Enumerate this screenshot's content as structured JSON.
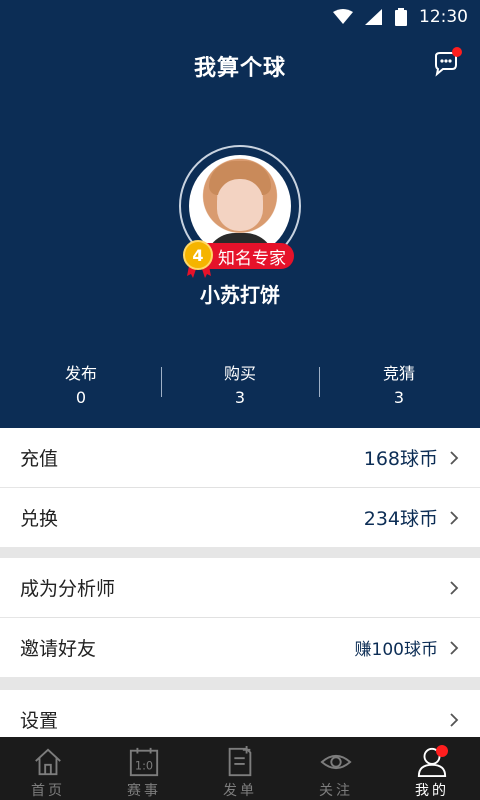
{
  "status_bar": {
    "time": "12:30",
    "icons": [
      "wifi-icon",
      "signal-icon",
      "battery-icon"
    ]
  },
  "header": {
    "title": "我算个球",
    "message_icon": "chat-bubble-icon",
    "profile": {
      "level": "4",
      "badge": "知名专家",
      "name": "小苏打饼"
    },
    "stats": [
      {
        "label": "发布",
        "value": "0"
      },
      {
        "label": "购买",
        "value": "3"
      },
      {
        "label": "竞猜",
        "value": "3"
      }
    ]
  },
  "menu": {
    "recharge": {
      "label": "充值",
      "value": "168球币"
    },
    "exchange": {
      "label": "兑换",
      "value": "234球币"
    },
    "become_analyst": {
      "label": "成为分析师"
    },
    "invite": {
      "label": "邀请好友",
      "value": "赚100球币"
    },
    "settings": {
      "label": "设置"
    }
  },
  "tabbar": {
    "items": [
      {
        "label": "首页",
        "icon": "home-icon"
      },
      {
        "label": "赛事",
        "icon": "scoreboard-icon"
      },
      {
        "label": "发单",
        "icon": "post-document-icon"
      },
      {
        "label": "关注",
        "icon": "eye-icon"
      },
      {
        "label": "我的",
        "icon": "user-icon"
      }
    ],
    "active": "我的"
  },
  "colors": {
    "header_bg": "#0c2d55",
    "accent_red": "#e6122a",
    "tabbar_bg": "#1b1b1b"
  }
}
